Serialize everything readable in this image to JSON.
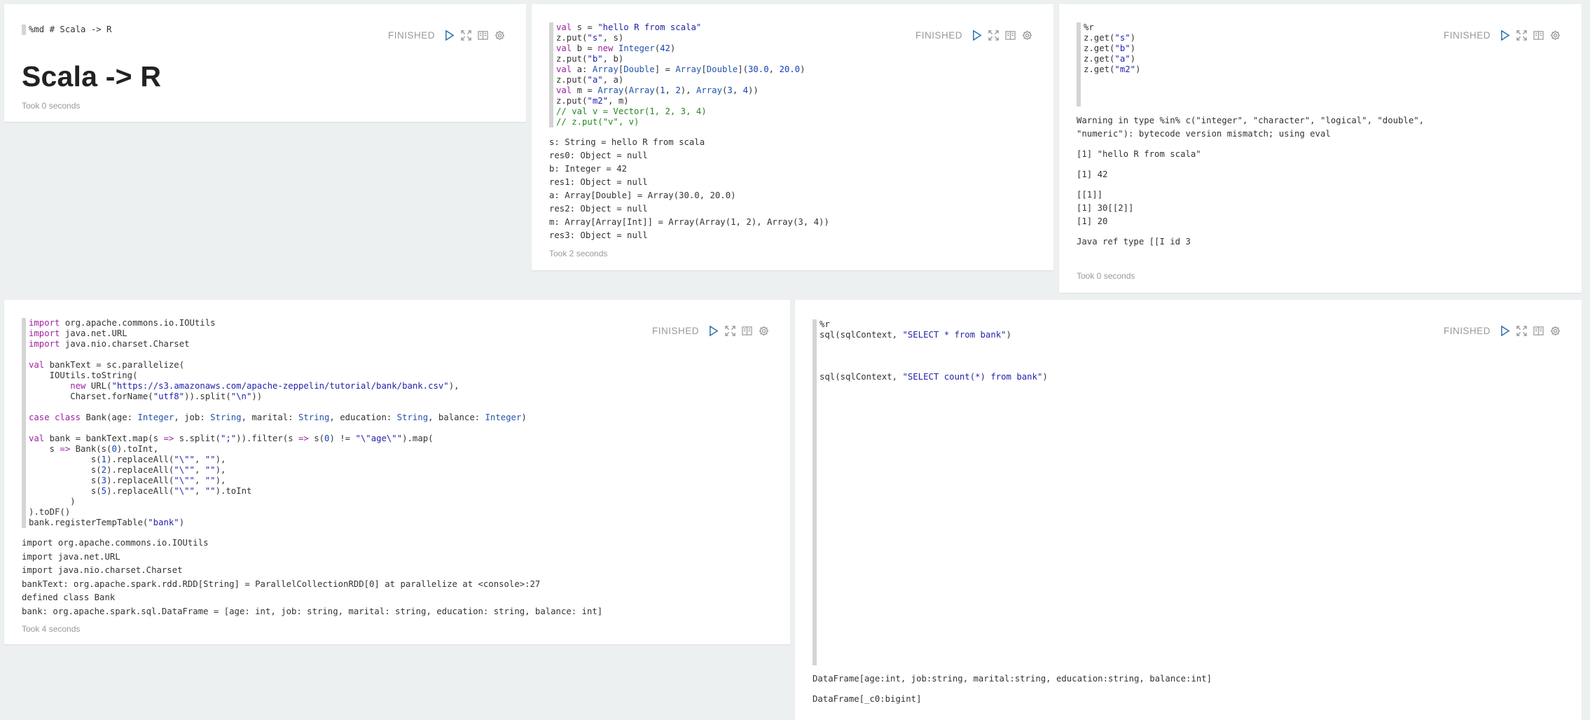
{
  "colors": {
    "background": "#ecf0f1",
    "card": "#ffffff",
    "status": "#999999",
    "run_icon": "#3071a9",
    "icon": "#999999",
    "editor_bar": "#d4d4d4",
    "keyword": "#a020a0",
    "type": "#2255aa",
    "string": "#2222aa",
    "number": "#1140bb",
    "comment": "#228822"
  },
  "icons": [
    "play-icon",
    "expand-icon",
    "book-icon",
    "gear-icon"
  ],
  "paragraphs": [
    {
      "status": "FINISHED",
      "code": [
        "%md # Scala -> R"
      ],
      "rendered_title": "Scala -> R",
      "output": [],
      "took": "Took 0 seconds"
    },
    {
      "status": "FINISHED",
      "code": [
        "val s = \"hello R from scala\"",
        "z.put(\"s\", s)",
        "val b = new Integer(42)",
        "z.put(\"b\", b)",
        "val a: Array[Double] = Array[Double](30.0, 20.0)",
        "z.put(\"a\", a)",
        "val m = Array(Array(1, 2), Array(3, 4))",
        "z.put(\"m2\", m)",
        "// val v = Vector(1, 2, 3, 4)",
        "// z.put(\"v\", v)"
      ],
      "output": [
        "s: String = hello R from scala",
        "res0: Object = null",
        "b: Integer = 42",
        "res1: Object = null",
        "a: Array[Double] = Array(30.0, 20.0)",
        "res2: Object = null",
        "m: Array[Array[Int]] = Array(Array(1, 2), Array(3, 4))",
        "res3: Object = null"
      ],
      "took": "Took 2 seconds"
    },
    {
      "status": "FINISHED",
      "code": [
        "%r",
        "z.get(\"s\")",
        "z.get(\"b\")",
        "z.get(\"a\")",
        "z.get(\"m2\")"
      ],
      "output": [
        "Warning in type %in% c(\"integer\", \"character\", \"logical\", \"double\",",
        "\"numeric\"): bytecode version mismatch; using eval",
        "",
        "[1] \"hello R from scala\"",
        "",
        "[1] 42",
        "",
        "[[1]]",
        "[1] 30[[2]]",
        "[1] 20",
        "",
        "Java ref type [[I id 3"
      ],
      "took": "Took 0 seconds"
    },
    {
      "status": "FINISHED",
      "code": [
        "import org.apache.commons.io.IOUtils",
        "import java.net.URL",
        "import java.nio.charset.Charset",
        "",
        "val bankText = sc.parallelize(",
        "    IOUtils.toString(",
        "        new URL(\"https://s3.amazonaws.com/apache-zeppelin/tutorial/bank/bank.csv\"),",
        "        Charset.forName(\"utf8\")).split(\"\\n\"))",
        "",
        "case class Bank(age: Integer, job: String, marital: String, education: String, balance: Integer)",
        "",
        "val bank = bankText.map(s => s.split(\";\")).filter(s => s(0) != \"\\\"age\\\"\").map(",
        "    s => Bank(s(0).toInt,",
        "            s(1).replaceAll(\"\\\"\", \"\"),",
        "            s(2).replaceAll(\"\\\"\", \"\"),",
        "            s(3).replaceAll(\"\\\"\", \"\"),",
        "            s(5).replaceAll(\"\\\"\", \"\").toInt",
        "        )",
        ").toDF()",
        "bank.registerTempTable(\"bank\")"
      ],
      "output": [
        "import org.apache.commons.io.IOUtils",
        "import java.net.URL",
        "import java.nio.charset.Charset",
        "bankText: org.apache.spark.rdd.RDD[String] = ParallelCollectionRDD[0] at parallelize at <console>:27",
        "defined class Bank",
        "bank: org.apache.spark.sql.DataFrame = [age: int, job: string, marital: string, education: string, balance: int]"
      ],
      "took": "Took 4 seconds"
    },
    {
      "status": "FINISHED",
      "code": [
        "%r",
        "sql(sqlContext, \"SELECT * from bank\")",
        "",
        "",
        "",
        "sql(sqlContext, \"SELECT count(*) from bank\")"
      ],
      "output": [
        "DataFrame[age:int, job:string, marital:string, education:string, balance:int]",
        "",
        "DataFrame[_c0:bigint]"
      ],
      "took": ""
    }
  ]
}
